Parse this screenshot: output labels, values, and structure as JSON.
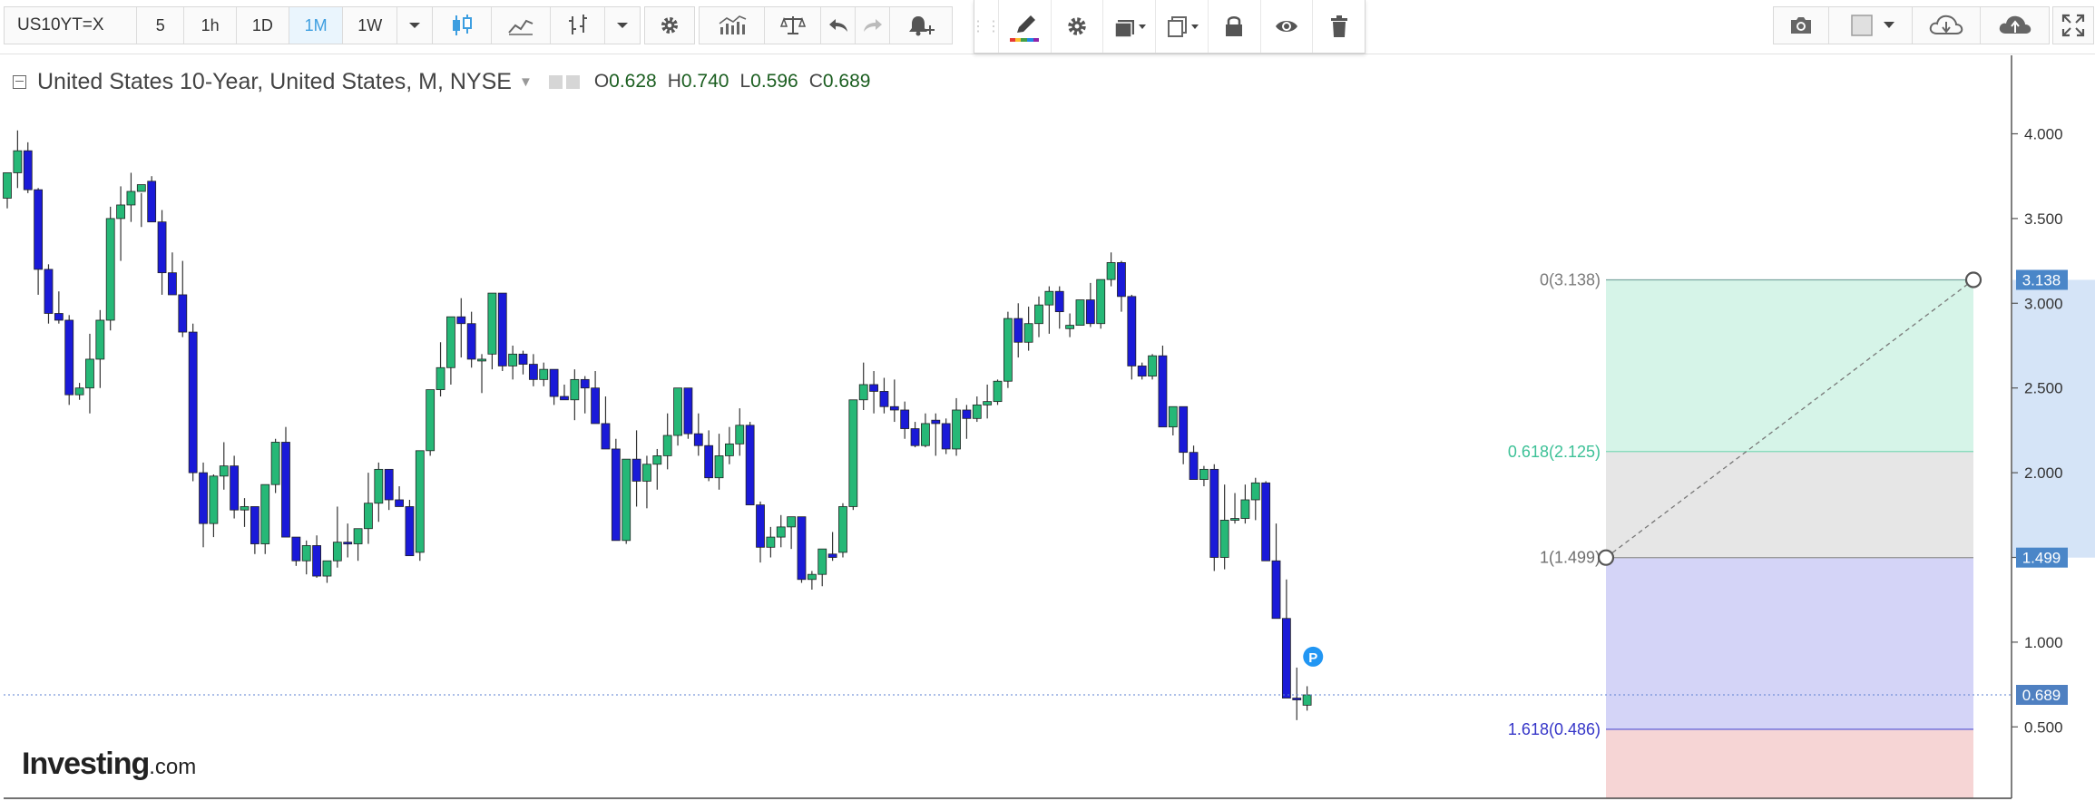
{
  "toolbar": {
    "symbol": "US10YT=X",
    "intervals": [
      "5",
      "1h",
      "1D",
      "1M",
      "1W"
    ],
    "active_interval": "1M",
    "icons": [
      "interval-dropdown-icon",
      "candles-icon",
      "line-chart-icon",
      "bar-type-icon",
      "chart-type-dropdown-icon",
      "settings-gear-icon",
      "indicators-icon",
      "compare-scale-icon",
      "undo-icon",
      "redo-icon",
      "alert-bell-icon",
      "camera-icon",
      "color-square-icon",
      "cloud-download-icon",
      "cloud-upload-icon",
      "fullscreen-icon"
    ]
  },
  "drawing_toolbar": {
    "icons": [
      "pencil-icon",
      "settings-gear-icon",
      "layers-icon",
      "clone-icon",
      "lock-icon",
      "eye-icon",
      "trash-icon"
    ],
    "accent_colors": [
      "#e53935",
      "#fbc02d",
      "#43a047",
      "#1e88e5",
      "#8e24aa"
    ]
  },
  "legend": {
    "title": "United States 10-Year, United States, M, NYSE",
    "open_label": "O",
    "open": "0.628",
    "high_label": "H",
    "high": "0.740",
    "low_label": "L",
    "low": "0.596",
    "close_label": "C",
    "close": "0.689"
  },
  "watermark": {
    "brand": "Investing",
    "domain": ".com"
  },
  "colors": {
    "up_candle": "#26b877",
    "down_candle": "#1a1ad8",
    "fib_zone_0_0618": "#d6f4e8",
    "fib_zone_0618_1": "#e6e6e6",
    "fib_zone_1_1618": "#d4d4f7",
    "fib_zone_below_1618": "#f6d5d5",
    "axis_badge": "#4a86c8",
    "price_badge": "#4f80c1",
    "axis_highlight": "#d5e4f7"
  },
  "chart_data": {
    "type": "candlestick",
    "period": "M",
    "y_axis": {
      "ticks": [
        4.0,
        3.5,
        3.0,
        2.5,
        2.0,
        1.5,
        1.0,
        0.5
      ],
      "tick_labels": [
        "4.000",
        "3.500",
        "3.000",
        "2.500",
        "2.000",
        "1.500",
        "1.000",
        "0.500"
      ],
      "range": [
        0.16,
        4.5
      ]
    },
    "current_price": {
      "value": 0.689,
      "label": "0.689"
    },
    "ohlc": [
      [
        3.62,
        3.77,
        3.56,
        3.77
      ],
      [
        3.77,
        4.02,
        3.68,
        3.9
      ],
      [
        3.9,
        3.95,
        3.65,
        3.67
      ],
      [
        3.67,
        3.68,
        3.05,
        3.2
      ],
      [
        3.2,
        3.23,
        2.88,
        2.94
      ],
      [
        2.94,
        3.07,
        2.88,
        2.9
      ],
      [
        2.9,
        2.93,
        2.4,
        2.46
      ],
      [
        2.46,
        2.53,
        2.43,
        2.5
      ],
      [
        2.5,
        2.82,
        2.35,
        2.67
      ],
      [
        2.67,
        2.96,
        2.5,
        2.9
      ],
      [
        2.9,
        3.57,
        2.84,
        3.5
      ],
      [
        3.5,
        3.69,
        3.25,
        3.58
      ],
      [
        3.58,
        3.77,
        3.48,
        3.66
      ],
      [
        3.66,
        3.65,
        3.45,
        3.7
      ],
      [
        3.72,
        3.75,
        3.5,
        3.48
      ],
      [
        3.48,
        3.55,
        3.05,
        3.18
      ],
      [
        3.18,
        3.3,
        3.05,
        3.05
      ],
      [
        3.05,
        3.25,
        2.8,
        2.83
      ],
      [
        2.83,
        2.88,
        1.95,
        2.0
      ],
      [
        2.0,
        2.06,
        1.56,
        1.7
      ],
      [
        1.7,
        1.99,
        1.62,
        1.98
      ],
      [
        1.98,
        2.18,
        1.9,
        2.04
      ],
      [
        2.04,
        2.1,
        1.73,
        1.78
      ],
      [
        1.78,
        1.85,
        1.68,
        1.8
      ],
      [
        1.8,
        1.8,
        1.52,
        1.58
      ],
      [
        1.58,
        1.87,
        1.52,
        1.93
      ],
      [
        1.93,
        2.2,
        1.88,
        2.18
      ],
      [
        2.18,
        2.27,
        1.7,
        1.62
      ],
      [
        1.62,
        1.62,
        1.45,
        1.48
      ],
      [
        1.48,
        1.6,
        1.4,
        1.57
      ],
      [
        1.57,
        1.63,
        1.38,
        1.39
      ],
      [
        1.39,
        1.42,
        1.35,
        1.48
      ],
      [
        1.48,
        1.8,
        1.44,
        1.59
      ],
      [
        1.59,
        1.7,
        1.5,
        1.58
      ],
      [
        1.58,
        1.65,
        1.48,
        1.67
      ],
      [
        1.67,
        2.0,
        1.58,
        1.82
      ],
      [
        1.82,
        2.06,
        1.71,
        2.02
      ],
      [
        2.02,
        2.0,
        1.78,
        1.84
      ],
      [
        1.84,
        1.92,
        1.8,
        1.8
      ],
      [
        1.8,
        1.84,
        1.57,
        1.51
      ],
      [
        1.53,
        1.67,
        1.48,
        2.13
      ],
      [
        2.13,
        2.4,
        2.1,
        2.49
      ],
      [
        2.49,
        2.77,
        2.45,
        2.62
      ],
      [
        2.62,
        2.82,
        2.52,
        2.92
      ],
      [
        2.92,
        3.03,
        2.68,
        2.88
      ],
      [
        2.88,
        2.95,
        2.62,
        2.67
      ],
      [
        2.67,
        2.7,
        2.47,
        2.67
      ],
      [
        2.7,
        3.05,
        2.61,
        3.06
      ],
      [
        3.06,
        3.05,
        2.6,
        2.63
      ],
      [
        2.63,
        2.75,
        2.55,
        2.7
      ],
      [
        2.7,
        2.72,
        2.58,
        2.64
      ],
      [
        2.64,
        2.7,
        2.51,
        2.55
      ],
      [
        2.55,
        2.65,
        2.51,
        2.61
      ],
      [
        2.61,
        2.6,
        2.4,
        2.45
      ],
      [
        2.45,
        2.52,
        2.43,
        2.43
      ],
      [
        2.43,
        2.61,
        2.31,
        2.55
      ],
      [
        2.55,
        2.57,
        2.35,
        2.5
      ],
      [
        2.5,
        2.6,
        2.35,
        2.29
      ],
      [
        2.29,
        2.45,
        2.18,
        2.14
      ],
      [
        2.14,
        2.2,
        1.7,
        1.6
      ],
      [
        1.6,
        2.07,
        1.58,
        2.08
      ],
      [
        2.08,
        2.25,
        1.8,
        1.95
      ],
      [
        1.95,
        2.1,
        1.79,
        2.05
      ],
      [
        2.05,
        2.14,
        1.9,
        2.1
      ],
      [
        2.1,
        2.35,
        2.02,
        2.22
      ],
      [
        2.22,
        2.48,
        2.16,
        2.5
      ],
      [
        2.5,
        2.45,
        2.2,
        2.23
      ],
      [
        2.23,
        2.35,
        2.1,
        2.16
      ],
      [
        2.16,
        2.25,
        1.95,
        1.97
      ],
      [
        1.97,
        2.23,
        1.9,
        2.1
      ],
      [
        2.1,
        2.27,
        2.05,
        2.17
      ],
      [
        2.17,
        2.38,
        2.1,
        2.28
      ],
      [
        2.28,
        2.3,
        1.83,
        1.81
      ],
      [
        1.81,
        1.83,
        1.47,
        1.56
      ],
      [
        1.56,
        1.68,
        1.5,
        1.62
      ],
      [
        1.62,
        1.75,
        1.56,
        1.68
      ],
      [
        1.68,
        1.72,
        1.55,
        1.74
      ],
      [
        1.74,
        1.7,
        1.35,
        1.37
      ],
      [
        1.37,
        1.42,
        1.31,
        1.4
      ],
      [
        1.4,
        1.53,
        1.33,
        1.55
      ],
      [
        1.52,
        1.65,
        1.48,
        1.5
      ],
      [
        1.53,
        1.82,
        1.5,
        1.8
      ],
      [
        1.8,
        2.4,
        1.78,
        2.43
      ],
      [
        2.43,
        2.65,
        2.37,
        2.52
      ],
      [
        2.52,
        2.6,
        2.35,
        2.48
      ],
      [
        2.48,
        2.56,
        2.35,
        2.39
      ],
      [
        2.39,
        2.55,
        2.3,
        2.37
      ],
      [
        2.37,
        2.42,
        2.2,
        2.26
      ],
      [
        2.26,
        2.3,
        2.15,
        2.16
      ],
      [
        2.16,
        2.35,
        2.15,
        2.29
      ],
      [
        2.31,
        2.35,
        2.1,
        2.29
      ],
      [
        2.29,
        2.32,
        2.11,
        2.14
      ],
      [
        2.14,
        2.44,
        2.1,
        2.37
      ],
      [
        2.37,
        2.4,
        2.2,
        2.32
      ],
      [
        2.32,
        2.45,
        2.3,
        2.4
      ],
      [
        2.4,
        2.52,
        2.32,
        2.42
      ],
      [
        2.42,
        2.55,
        2.4,
        2.54
      ],
      [
        2.54,
        2.95,
        2.5,
        2.91
      ],
      [
        2.91,
        3.0,
        2.68,
        2.77
      ],
      [
        2.77,
        2.98,
        2.72,
        2.88
      ],
      [
        2.88,
        3.04,
        2.8,
        2.99
      ],
      [
        2.99,
        3.1,
        2.82,
        3.07
      ],
      [
        3.07,
        3.1,
        2.85,
        2.95
      ],
      [
        2.85,
        2.94,
        2.8,
        2.87
      ],
      [
        2.87,
        3.0,
        2.87,
        3.02
      ],
      [
        3.02,
        3.12,
        2.86,
        2.88
      ],
      [
        2.88,
        3.12,
        2.85,
        3.14
      ],
      [
        3.14,
        3.3,
        3.1,
        3.24
      ],
      [
        3.24,
        3.25,
        2.95,
        3.04
      ],
      [
        3.04,
        3.05,
        2.55,
        2.63
      ],
      [
        2.63,
        2.65,
        2.55,
        2.57
      ],
      [
        2.57,
        2.7,
        2.55,
        2.69
      ],
      [
        2.69,
        2.75,
        2.35,
        2.27
      ],
      [
        2.27,
        2.35,
        2.22,
        2.39
      ],
      [
        2.39,
        2.38,
        2.05,
        2.12
      ],
      [
        2.12,
        2.16,
        1.97,
        1.96
      ],
      [
        1.96,
        2.04,
        1.92,
        2.02
      ],
      [
        2.02,
        2.05,
        1.42,
        1.5
      ],
      [
        1.5,
        1.93,
        1.43,
        1.72
      ],
      [
        1.72,
        1.88,
        1.7,
        1.73
      ],
      [
        1.73,
        1.93,
        1.7,
        1.84
      ],
      [
        1.84,
        1.97,
        1.72,
        1.94
      ],
      [
        1.94,
        1.95,
        1.48,
        1.48
      ],
      [
        1.48,
        1.7,
        1.45,
        1.14
      ],
      [
        1.14,
        1.37,
        0.87,
        0.67
      ],
      [
        0.67,
        0.85,
        0.54,
        0.66
      ],
      [
        0.628,
        0.74,
        0.596,
        0.689
      ]
    ],
    "fibonacci": {
      "levels": [
        {
          "label": "0(3.138)",
          "ratio": 0,
          "value": 3.138
        },
        {
          "label": "0.618(2.125)",
          "ratio": 0.618,
          "value": 2.125
        },
        {
          "label": "1(1.499)",
          "ratio": 1,
          "value": 1.499
        },
        {
          "label": "1.618(0.486)",
          "ratio": 1.618,
          "value": 0.486
        }
      ],
      "anchors": [
        {
          "value": 1.499
        },
        {
          "value": 3.138
        }
      ],
      "axis_labels": [
        "3.138",
        "1.499"
      ],
      "marker_label": "P"
    }
  }
}
